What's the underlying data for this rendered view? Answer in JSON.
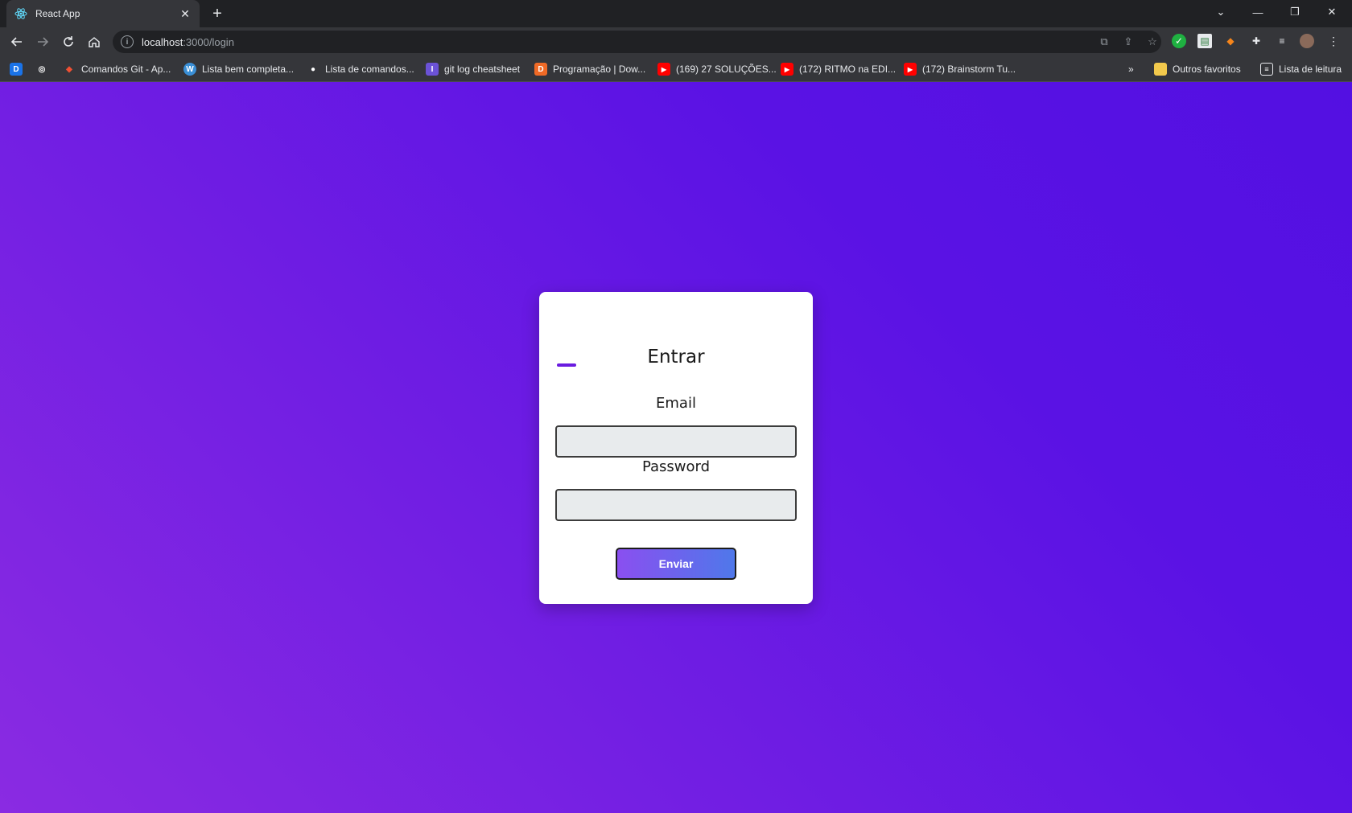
{
  "browser": {
    "tab": {
      "title": "React App",
      "close": "✕"
    },
    "new_tab": "+",
    "url_host": "localhost",
    "url_path": ":3000/login",
    "window_controls": {
      "dropdown": "⌄",
      "minimize": "—",
      "restore": "❐",
      "close": "✕"
    }
  },
  "bookmarks": [
    {
      "label": "",
      "icon": "D",
      "color": "#1a73e8"
    },
    {
      "label": "",
      "icon": "◎",
      "color": "#35363a"
    },
    {
      "label": "Comandos Git - Ap...",
      "icon": "◆",
      "color": "#f05033"
    },
    {
      "label": "Lista bem completa...",
      "icon": "W",
      "color": "#3a8fd6"
    },
    {
      "label": "Lista de comandos...",
      "icon": "●",
      "color": "#35363a"
    },
    {
      "label": "git log cheatsheet",
      "icon": "I",
      "color": "#6b52d6"
    },
    {
      "label": "Programação | Dow...",
      "icon": "D",
      "color": "#f06a26"
    },
    {
      "label": "(169) 27 SOLUÇÕES...",
      "icon": "▶",
      "color": "#ff0000"
    },
    {
      "label": "(172) RITMO na EDI...",
      "icon": "▶",
      "color": "#ff0000"
    },
    {
      "label": "(172) Brainstorm Tu...",
      "icon": "▶",
      "color": "#ff0000"
    }
  ],
  "bookmarks_right": {
    "more": "»",
    "other": "Outros favoritos",
    "reading": "Lista de leitura"
  },
  "login": {
    "title": "Entrar",
    "email_label": "Email",
    "email_value": "",
    "password_label": "Password",
    "password_value": "",
    "submit_label": "Enviar"
  }
}
